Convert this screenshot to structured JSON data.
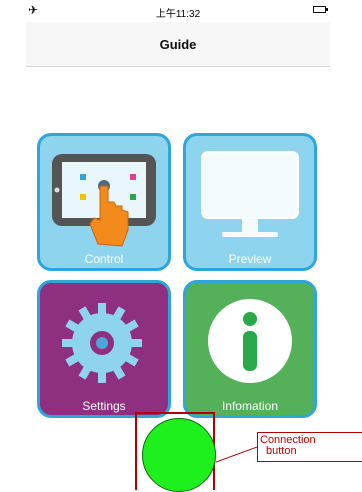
{
  "status_bar": {
    "time": "上午11:32"
  },
  "nav": {
    "title": "Guide"
  },
  "tiles": [
    {
      "label": "Control",
      "icon": "tablet-touch-icon"
    },
    {
      "label": "Preview",
      "icon": "monitor-icon"
    },
    {
      "label": "Settings",
      "icon": "gear-icon"
    },
    {
      "label": "Infomation",
      "icon": "info-icon"
    }
  ],
  "annotation": {
    "line1": "Connection",
    "line2": "button"
  },
  "colors": {
    "tile_blue": "#8ed4ef",
    "tile_border": "#2da6dc",
    "settings_purple": "#8f2f7f",
    "info_green": "#55b05a",
    "connection_green": "#1ef01e",
    "annotation_red": "#c00000"
  }
}
